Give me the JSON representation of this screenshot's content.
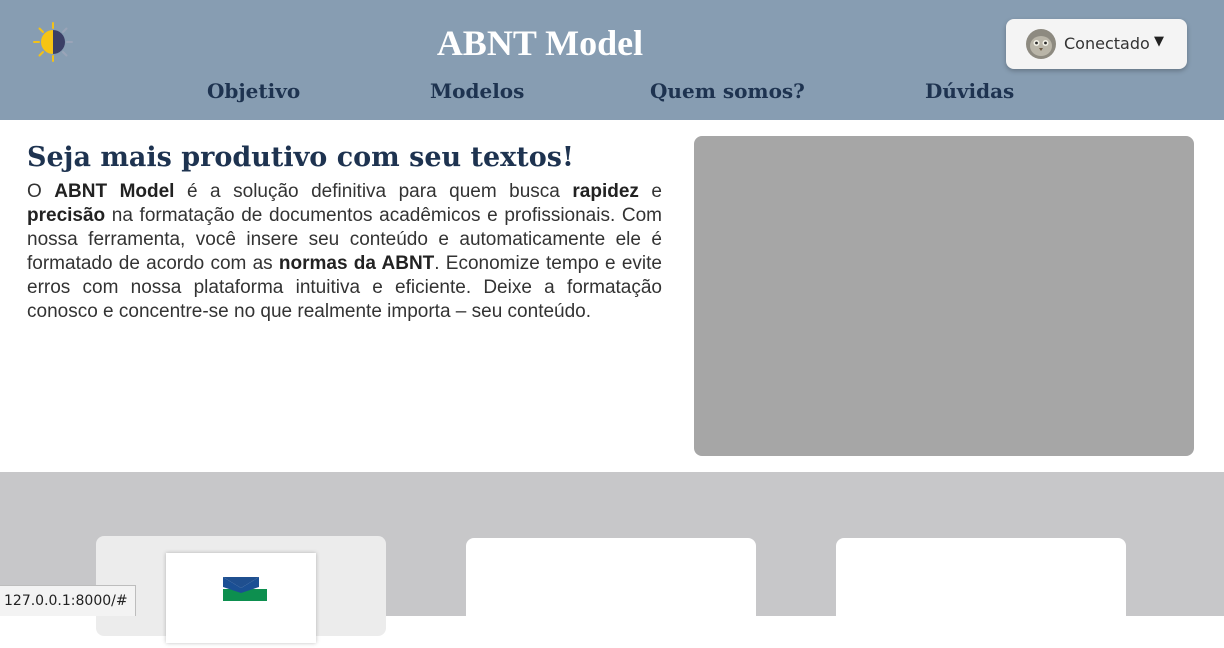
{
  "header": {
    "title": "ABNT Model",
    "theme_toggle_icon": "sun-moon-icon",
    "user_menu": {
      "status": "Conectado",
      "caret": "▼",
      "avatar_icon": "avatar"
    },
    "nav": [
      {
        "label": "Objetivo"
      },
      {
        "label": "Modelos"
      },
      {
        "label": "Quem somos?"
      },
      {
        "label": "Dúvidas"
      }
    ]
  },
  "hero": {
    "title": "Seja mais produtivo com seu textos!",
    "p1": "O ",
    "b1": "ABNT Model",
    "p2": " é a solução definitiva para quem busca ",
    "b2": "rapidez",
    "p3": " e ",
    "b3": "precisão",
    "p4": " na formatação de documentos acadêmicos e profissionais. Com nossa ferramenta, você insere seu conteúdo e automaticamente ele é formatado de acordo com as ",
    "b4": "normas da ABNT",
    "p5": ". Economize tempo e evite erros com nossa plataforma intuitiva e eficiente. Deixe a formatação conosco e concentre-se no que realmente importa – seu conteúdo."
  },
  "cards": [
    {
      "logo_icon": "university-logo-icon"
    },
    {},
    {}
  ],
  "status_bar": {
    "url": "127.0.0.1:8000/#"
  },
  "colors": {
    "header_bg": "#879db2",
    "nav_text": "#1e3350",
    "placeholder": "#a6a6a6",
    "section_bg": "#c7c7c9"
  }
}
